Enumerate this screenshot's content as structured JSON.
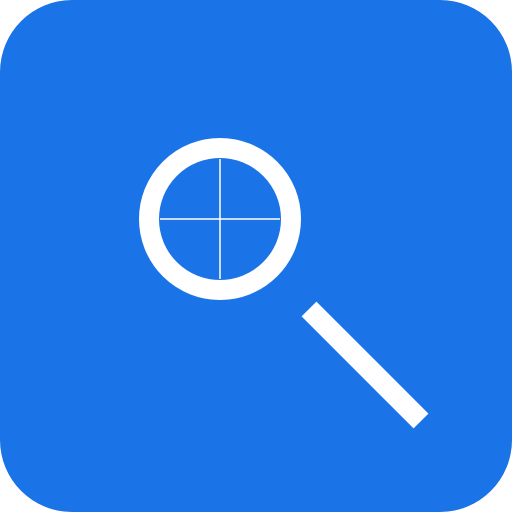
{
  "app_icon": {
    "name": "magnifier-with-crosshair",
    "background_color": "#1b73e8",
    "foreground_color": "#ffffff"
  }
}
